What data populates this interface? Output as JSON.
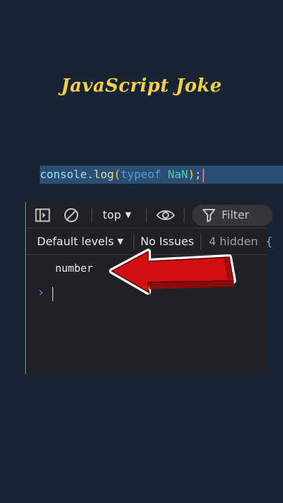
{
  "title": "JavaScript Joke",
  "code": {
    "ident": "console",
    "dot": ".",
    "fn": "log",
    "open_paren": "(",
    "keyword": "typeof",
    "space": " ",
    "nan": "NaN",
    "close_paren": ")",
    "semicolon": ";"
  },
  "devtools": {
    "toolbar": {
      "sidebar_icon": "sidebar-toggle-icon",
      "clear_icon": "clear-console-icon",
      "context_label": "top",
      "eye_icon": "live-expression-eye-icon",
      "filter_label": "Filter"
    },
    "toolbar2": {
      "levels_label": "Default levels",
      "issues_label": "No Issues",
      "hidden_label": "4 hidden",
      "tail_text": "{"
    },
    "console": {
      "output": "number",
      "prompt_symbol": "›"
    }
  },
  "colors": {
    "background": "#172433",
    "title": "#f4d03f",
    "code_highlight": "#2b4f72",
    "arrow": "#d10f0f"
  },
  "annotation": {
    "arrow_icon": "red-arrow-pointing-left-icon"
  }
}
